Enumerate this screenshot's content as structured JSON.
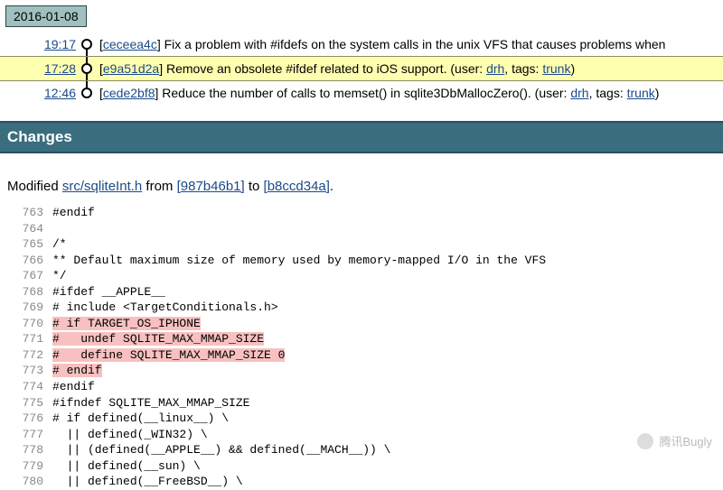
{
  "date_badge": "2016-01-08",
  "timeline": [
    {
      "time": "19:17",
      "hash": "ceceea4c",
      "msg_prefix": "Fix a problem with #ifdefs on the system calls in the unix VFS that causes problems when",
      "highlight": false
    },
    {
      "time": "17:28",
      "hash": "e9a51d2a",
      "msg_prefix": "Remove an obsolete #ifdef related to iOS support. (user: ",
      "user": "drh",
      "tags_label": ", tags: ",
      "tag": "trunk",
      "tail": ")",
      "highlight": true
    },
    {
      "time": "12:46",
      "hash": "cede2bf8",
      "msg_prefix": "Reduce the number of calls to memset() in sqlite3DbMallocZero(). (user: ",
      "user": "drh",
      "tags_label": ", tags: ",
      "tag": "trunk",
      "tail": ")",
      "highlight": false
    }
  ],
  "changes_heading": "Changes",
  "modified": {
    "prefix": "Modified ",
    "file": "src/sqliteInt.h",
    "mid1": " from ",
    "from_hash": "[987b46b1]",
    "mid2": " to ",
    "to_hash": "[b8ccd34a]",
    "tail": "."
  },
  "code": [
    {
      "n": "763",
      "t": "#endif",
      "d": false
    },
    {
      "n": "764",
      "t": "",
      "d": false
    },
    {
      "n": "765",
      "t": "/*",
      "d": false
    },
    {
      "n": "766",
      "t": "** Default maximum size of memory used by memory-mapped I/O in the VFS",
      "d": false
    },
    {
      "n": "767",
      "t": "*/",
      "d": false
    },
    {
      "n": "768",
      "t": "#ifdef __APPLE__",
      "d": false
    },
    {
      "n": "769",
      "t": "# include <TargetConditionals.h>",
      "d": false
    },
    {
      "n": "770",
      "t": "# if TARGET_OS_IPHONE",
      "d": true
    },
    {
      "n": "771",
      "t": "#   undef SQLITE_MAX_MMAP_SIZE",
      "d": true
    },
    {
      "n": "772",
      "t": "#   define SQLITE_MAX_MMAP_SIZE 0",
      "d": true
    },
    {
      "n": "773",
      "t": "# endif",
      "d": true
    },
    {
      "n": "774",
      "t": "#endif",
      "d": false
    },
    {
      "n": "775",
      "t": "#ifndef SQLITE_MAX_MMAP_SIZE",
      "d": false
    },
    {
      "n": "776",
      "t": "# if defined(__linux__) \\",
      "d": false
    },
    {
      "n": "777",
      "t": "  || defined(_WIN32) \\",
      "d": false
    },
    {
      "n": "778",
      "t": "  || (defined(__APPLE__) && defined(__MACH__)) \\",
      "d": false
    },
    {
      "n": "779",
      "t": "  || defined(__sun) \\",
      "d": false
    },
    {
      "n": "780",
      "t": "  || defined(__FreeBSD__) \\",
      "d": false
    }
  ],
  "watermark": "腾讯Bugly"
}
